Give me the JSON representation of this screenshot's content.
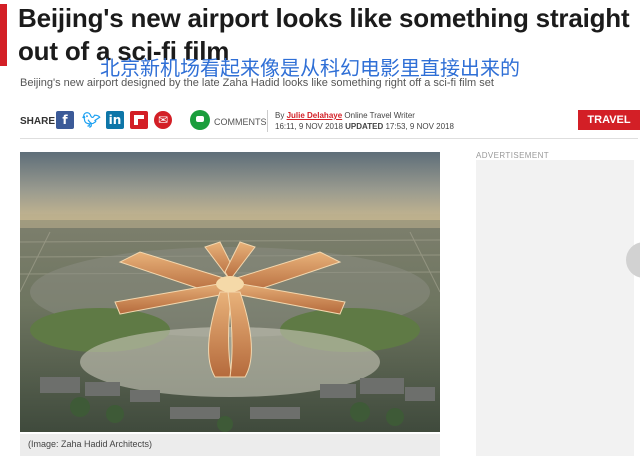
{
  "article": {
    "headline": "Beijing's new airport looks like something straight out of a sci-fi film",
    "overlay_caption_cn": "北京新机场看起来像是从科幻电影里直接出来的",
    "standfirst": "Beijing's new airport designed by the late Zaha Hadid looks like something right off a sci-fi film set",
    "by_prefix": "By",
    "author": "Julie Delahaye",
    "author_role": "Online Travel Writer",
    "published": "16:11, 9 NOV 2018",
    "updated_label": "UPDATED",
    "updated": "17:53, 9 NOV 2018",
    "section": "TRAVEL",
    "image_caption": "(Image: Zaha Hadid Architects)"
  },
  "share": {
    "label": "SHARE",
    "comments_label": "COMMENTS",
    "icons": [
      "facebook-icon",
      "twitter-icon",
      "linkedin-icon",
      "flipboard-icon",
      "email-icon",
      "comment-icon"
    ]
  },
  "sidebar": {
    "ad_label": "ADVERTISEMENT"
  },
  "colors": {
    "accent": "#d31f26",
    "link": "#2f6fd6",
    "comment": "#1a9e3c",
    "facebook": "#3b5a98",
    "linkedin": "#0e76a8"
  }
}
